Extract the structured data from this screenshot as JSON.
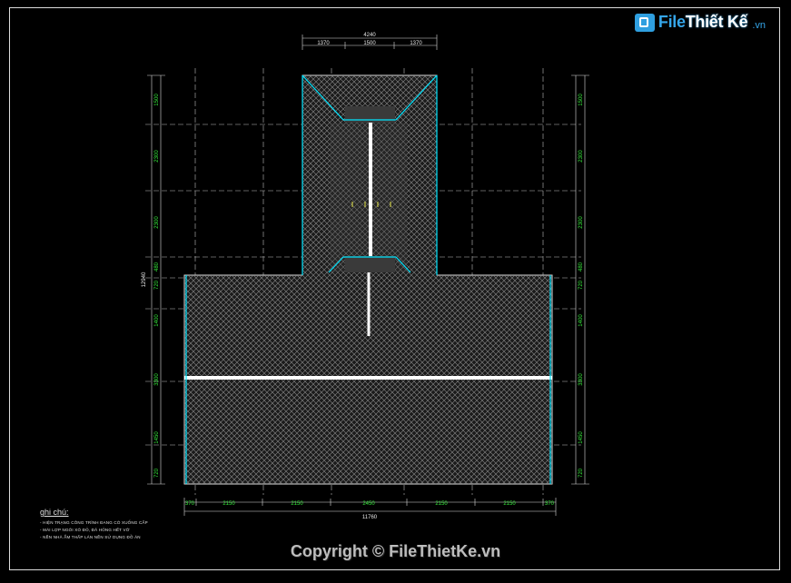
{
  "brand": {
    "name_part1": "File",
    "name_part2": "Thiết Kế",
    "tld": ".vn"
  },
  "copyright": "Copyright © FileThietKe.vn",
  "notes": {
    "title": "ghi chú:",
    "lines": [
      "- HIỆN TRẠNG CÔNG TRÌNH ĐANG CÓ XUỐNG CẤP",
      "- MÁI LỢP NGÓI XÓ ĐỎ, ĐÃ HỎNG HẾT VỠ",
      "- NỀN NHÀ ẨM THẤP LÁN NỀN SỬ DỤNG ĐỒ ÁN"
    ]
  },
  "dimensions": {
    "top_total": "4240",
    "top_parts": [
      "1370",
      "1500",
      "1370"
    ],
    "bottom_total": "11760",
    "bottom_parts": [
      "370",
      "2150",
      "2150",
      "2450",
      "2150",
      "2150",
      "370"
    ],
    "left_total": "12940",
    "side_parts": [
      "1500",
      "2300",
      "2300",
      "480",
      "720",
      "1400",
      "3300",
      "1450",
      "720"
    ]
  },
  "colors": {
    "background": "#000000",
    "dimension_text": "#35e83a",
    "roof_edge": "#00e5ff",
    "hatch": "#8a8a8a"
  }
}
